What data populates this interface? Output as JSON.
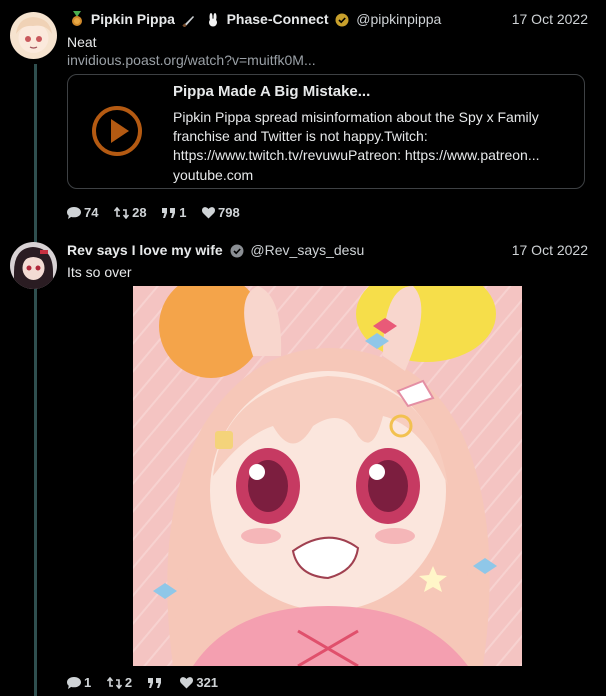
{
  "tweets": [
    {
      "author_name": "Pipkin Pippa",
      "name_suffix": "Phase-Connect",
      "handle": "@pipkinpippa",
      "date": "17 Oct 2022",
      "text": "Neat",
      "link": "invidious.poast.org/watch?v=muitfk0M...",
      "card": {
        "title": "Pippa Made A Big Mistake...",
        "description": "Pipkin Pippa spread misinformation about the Spy x Family franchise and Twitter is not happy.Twitch: https://www.twitch.tv/revuwuPatreon: https://www.patreon...",
        "domain": "youtube.com"
      },
      "stats": {
        "replies": "74",
        "retweets": "28",
        "quotes": "1",
        "likes": "798"
      }
    },
    {
      "author_name": "Rev says I love my wife",
      "handle": "@Rev_says_desu",
      "date": "17 Oct 2022",
      "text": "Its so over",
      "stats": {
        "replies": "1",
        "retweets": "2",
        "quotes": "",
        "likes": "321"
      }
    }
  ],
  "colors": {
    "background": "#000000",
    "thread_line": "#2f4f4f",
    "verified_gold": "#c8a02c",
    "verified_gray": "#8b8f94",
    "play_button": "#b45a12"
  },
  "icons": [
    "medal-icon",
    "knife-icon",
    "rabbit-icon",
    "verified-badge-icon",
    "reply-icon",
    "retweet-icon",
    "quote-icon",
    "like-icon",
    "play-icon"
  ]
}
